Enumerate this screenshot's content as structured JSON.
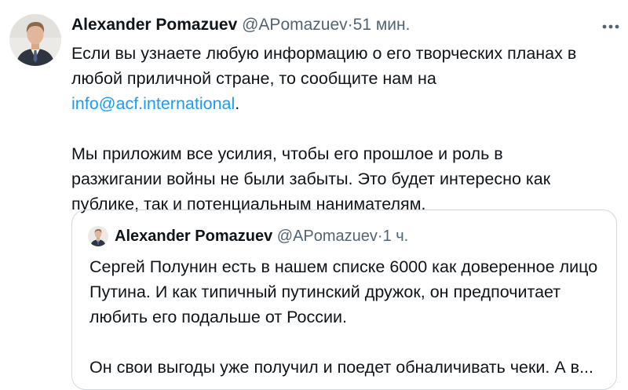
{
  "tweet": {
    "author_name": "Alexander Pomazuev",
    "handle": "@APomazuev",
    "separator": "·",
    "time": "51 мин.",
    "paragraph1_text": "Если вы узнаете любую информацию о его творческих планах в любой приличной стране, то сообщите нам на ",
    "paragraph1_link": "info@acf.international",
    "paragraph1_end": ".",
    "paragraph2": "Мы приложим все усилия, чтобы его прошлое и роль в разжигании войны не были забыты. Это будет интересно как публике, так и потенциальным нанимателям."
  },
  "quote": {
    "author_name": "Alexander Pomazuev",
    "handle": "@APomazuev",
    "separator": "·",
    "time": "1 ч.",
    "paragraph1": "Сергей Полунин есть в нашем списке 6000 как доверенное лицо Путина. И как типичный путинский дружок, он предпочитает любить его подальше от России.",
    "paragraph2": "Он свои выгоды уже получил и поедет обналичивать чеки. А в..."
  },
  "icons": {
    "avatar": "profile-photo",
    "quote_avatar": "profile-photo-small",
    "more": "more-horizontal-icon"
  }
}
